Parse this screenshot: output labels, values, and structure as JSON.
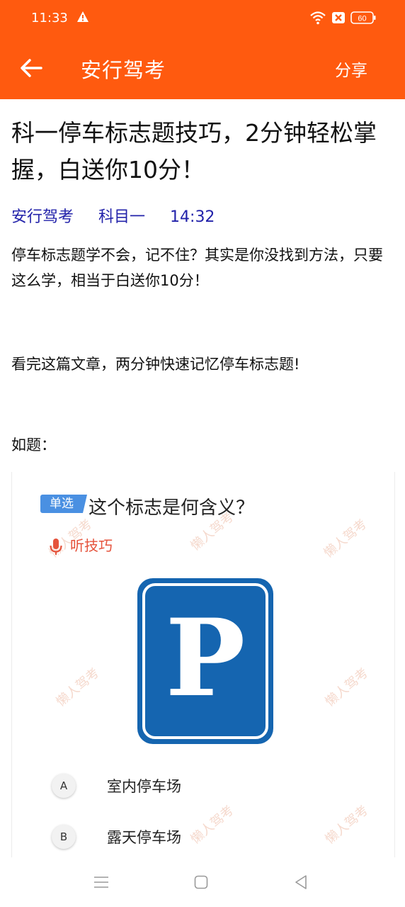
{
  "status_bar": {
    "time": "11:33",
    "battery": "60",
    "icons": [
      "warning-icon",
      "wifi-icon",
      "sim-icon",
      "battery-icon"
    ]
  },
  "app_bar": {
    "back_icon": "arrow-left-icon",
    "title": "安行驾考",
    "share_label": "分享"
  },
  "article": {
    "title": "科一停车标志题技巧，2分钟轻松掌握，白送你10分！",
    "meta": {
      "source": "安行驾考",
      "category": "科目一",
      "time": "14:32"
    },
    "paragraphs": [
      "停车标志题学不会，记不住？其实是你没找到方法，只要这么学，相当于白送你10分！",
      "看完这篇文章，两分钟快速记忆停车标志题!",
      "如题："
    ]
  },
  "question": {
    "badge": "单选",
    "text": "这个标志是何含义？",
    "listen_label": "听技巧",
    "sign_letter": "P",
    "watermark": "懒人驾考",
    "options": [
      {
        "letter": "A",
        "text": "室内停车场"
      },
      {
        "letter": "B",
        "text": "露天停车场"
      }
    ]
  },
  "colors": {
    "accent": "#ff5a0f",
    "meta_link": "#2222aa",
    "badge": "#4a90e2",
    "sign_blue": "#1565b0",
    "tip_red": "#e5533c"
  },
  "nav_bar": {
    "icons": [
      "menu-icon",
      "home-icon",
      "back-triangle-icon"
    ]
  }
}
